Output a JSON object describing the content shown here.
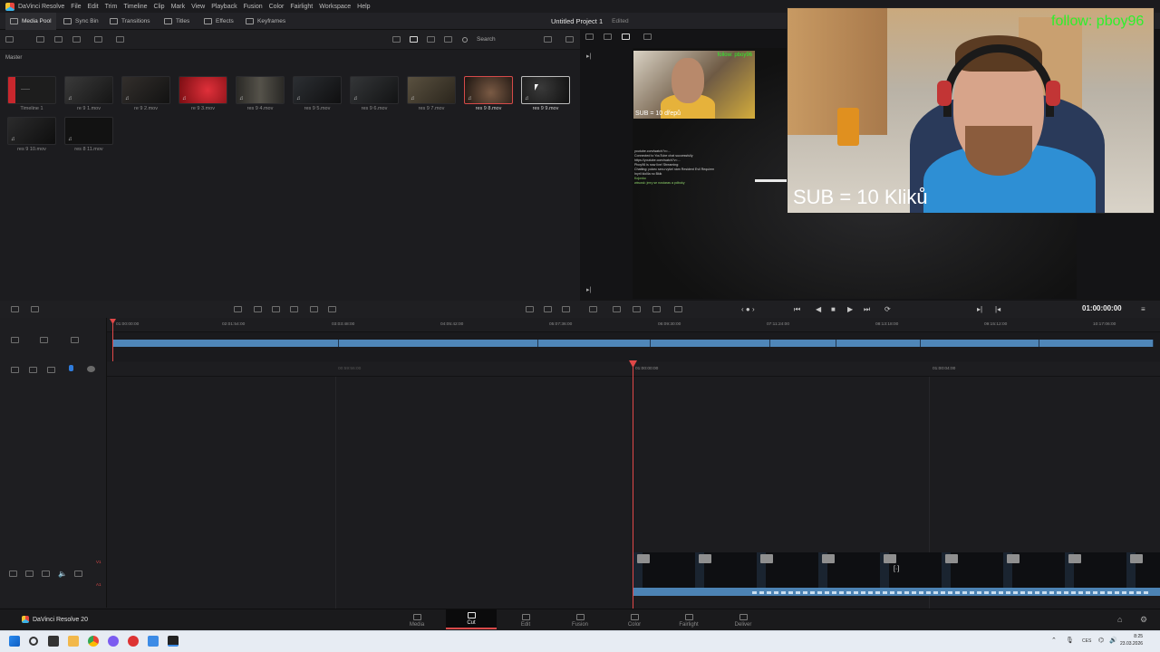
{
  "menubar": {
    "app": "DaVinci Resolve",
    "items": [
      "File",
      "Edit",
      "Trim",
      "Timeline",
      "Clip",
      "Mark",
      "View",
      "Playback",
      "Fusion",
      "Color",
      "Fairlight",
      "Workspace",
      "Help"
    ]
  },
  "toolbar": {
    "media_pool": "Media Pool",
    "sync_bin": "Sync Bin",
    "transitions": "Transitions",
    "titles": "Titles",
    "effects": "Effects",
    "keyframes": "Keyframes"
  },
  "project": {
    "title": "Untitled Project 1",
    "status": "Edited"
  },
  "pool": {
    "search_label": "Search",
    "bin": "Master",
    "clips": [
      {
        "name": "Timeline 1",
        "color": "#1d1d1d",
        "accent": "#c8272d"
      },
      {
        "name": "re 9 1.mov",
        "color": "#2a2a2a"
      },
      {
        "name": "re 9 2.mov",
        "color": "#262424"
      },
      {
        "name": "re 9 3.mov",
        "color": "#a3151d"
      },
      {
        "name": "res 9 4.mov",
        "color": "#3a3833"
      },
      {
        "name": "res 9 5.mov",
        "color": "#202224"
      },
      {
        "name": "res 9 6.mov",
        "color": "#28292b"
      },
      {
        "name": "res 9 7.mov",
        "color": "#4a4335"
      },
      {
        "name": "res 9 8.mov",
        "color": "#3a2c24"
      },
      {
        "name": "res 9 9.mov",
        "color": "#1e1e1e"
      },
      {
        "name": "res 9 10.mov",
        "color": "#1f1f20"
      },
      {
        "name": "res 8 11.mov",
        "color": "#161616"
      }
    ]
  },
  "viewer": {
    "timecode": "01:00:00:00",
    "pip_sub": "SUB = 10 dřepů",
    "webcam_sub": "SUB = 10 Kliků",
    "follow": "follow: pboy96",
    "pip_follow": "follow: pboy96",
    "chat": [
      "youtube.com/watch?v=...",
      "Connected to YouTube chat successfully",
      "https://youtube.com/watch?v=...",
      "Pboy96 is now live! Streaming: ",
      "Chatting: pokec sexu vyšel nám Resident Evil Requiem",
      "Inyrii kiolila no Bkik",
      "Kojovko",
      "wiwosk: jmry se nostaras a pdboky"
    ]
  },
  "timeline": {
    "upper_ticks": [
      "01:00:00:00",
      "02:01:54:00",
      "03:03:48:00",
      "04:05:42:00",
      "05:07:36:00",
      "06:09:30:00",
      "07:11:24:00",
      "08:13:18:00",
      "09:15:12:00",
      "10:17:06:00"
    ],
    "lower_ticks": [
      "00:59:56:00",
      "01:00:00:00",
      "01:00:04:00"
    ],
    "track_v": "V1",
    "track_a": "A1"
  },
  "pages": [
    "Media",
    "Cut",
    "Edit",
    "Fusion",
    "Color",
    "Fairlight",
    "Deliver"
  ],
  "active_page": "Cut",
  "brand": "DaVinci Resolve 20",
  "taskbar": {
    "lang": "CES",
    "time": "8:25",
    "date": "23.03.2026"
  }
}
